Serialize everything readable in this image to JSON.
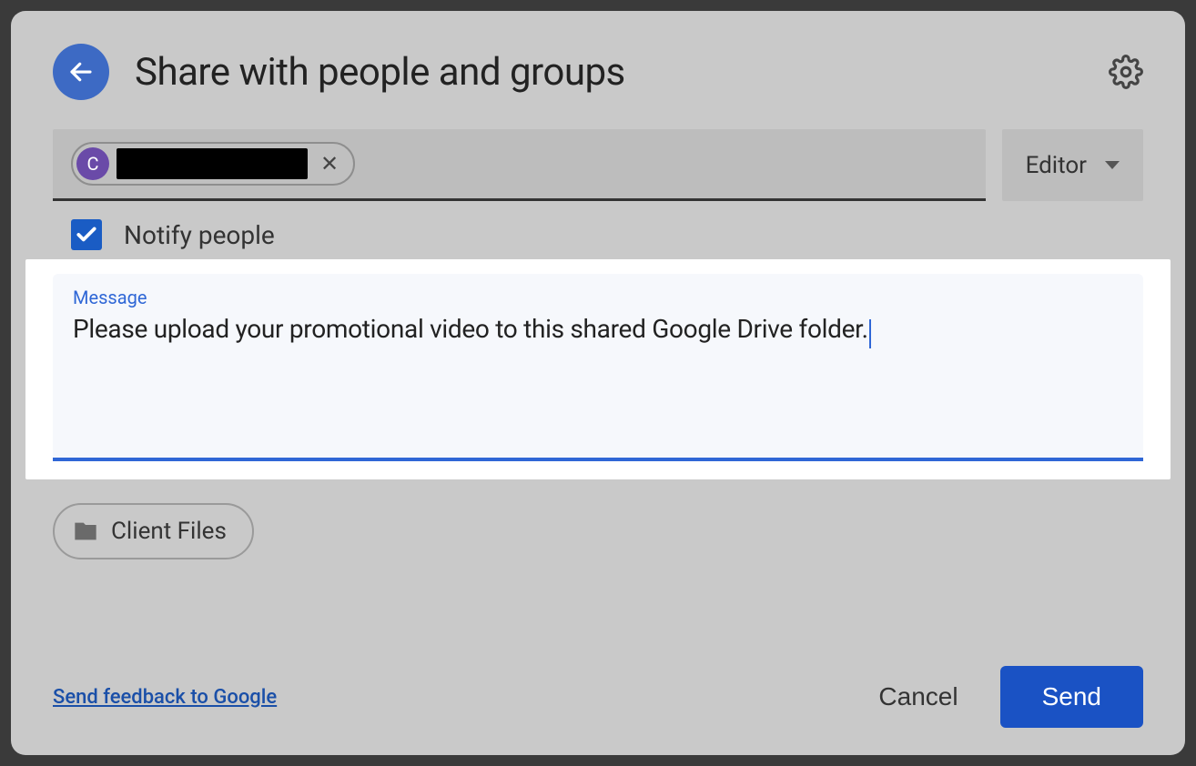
{
  "header": {
    "title": "Share with people and groups"
  },
  "recipient": {
    "avatar_initial": "C"
  },
  "role": {
    "selected": "Editor"
  },
  "notify": {
    "label": "Notify people",
    "checked": true
  },
  "message": {
    "label": "Message",
    "value": "Please upload your promotional video to this shared Google Drive folder."
  },
  "attachment": {
    "name": "Client Files"
  },
  "footer": {
    "feedback": "Send feedback to Google",
    "cancel": "Cancel",
    "send": "Send"
  }
}
